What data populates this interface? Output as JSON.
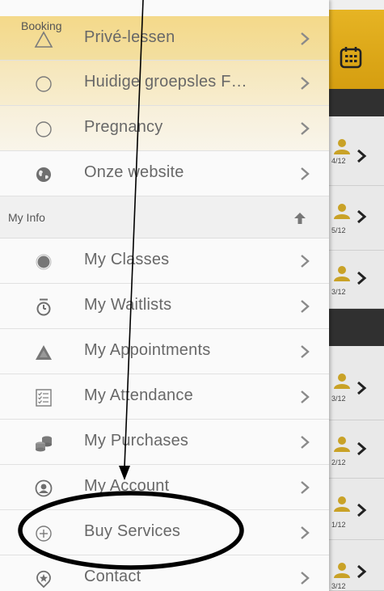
{
  "menu": {
    "booking_section_title": "Booking",
    "info_section_title": "My Info",
    "items": [
      {
        "label": "Privé-lessen",
        "icon": "triangle-outline-icon"
      },
      {
        "label": "Huidige groepsles F…",
        "icon": "circle-outline-icon"
      },
      {
        "label": "Pregnancy",
        "icon": "circle-outline-icon"
      },
      {
        "label": "Onze website",
        "icon": "globe-icon"
      },
      {
        "label": "My Classes",
        "icon": "filled-circle-icon"
      },
      {
        "label": "My Waitlists",
        "icon": "stopwatch-icon"
      },
      {
        "label": "My Appointments",
        "icon": "filled-triangle-icon"
      },
      {
        "label": "My Attendance",
        "icon": "checklist-icon"
      },
      {
        "label": "My Purchases",
        "icon": "coins-icon"
      },
      {
        "label": "My Account",
        "icon": "user-circle-icon"
      },
      {
        "label": "Buy Services",
        "icon": "plus-circle-icon"
      },
      {
        "label": "Contact",
        "icon": "star-pin-icon"
      }
    ]
  },
  "background": {
    "counts": [
      "4/12",
      "5/12",
      "3/12",
      "3/12",
      "2/12",
      "1/12",
      "3/12"
    ]
  },
  "colors": {
    "accent": "#d9a414",
    "drawer_bg": "#fafafa",
    "label_text": "#686868",
    "icon": "#7b7b7b"
  }
}
